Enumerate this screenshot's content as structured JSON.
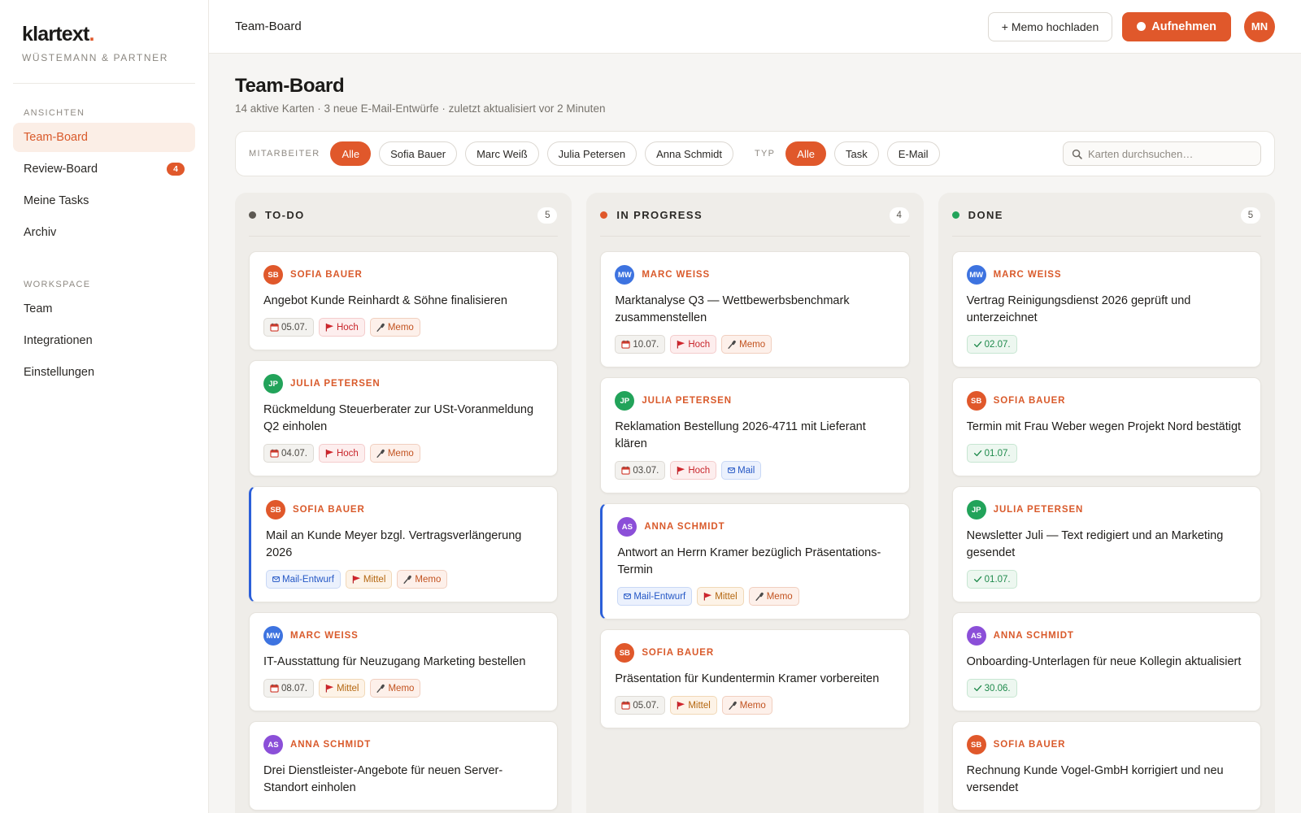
{
  "brand": {
    "name": "klartext",
    "dot": ".",
    "org": "WÜSTEMANN & PARTNER"
  },
  "sidebar": {
    "sections": [
      {
        "label": "ANSICHTEN",
        "items": [
          {
            "label": "Team-Board",
            "active": true
          },
          {
            "label": "Review-Board",
            "badge": "4"
          },
          {
            "label": "Meine Tasks"
          },
          {
            "label": "Archiv"
          }
        ]
      },
      {
        "label": "WORKSPACE",
        "items": [
          {
            "label": "Team"
          },
          {
            "label": "Integrationen"
          },
          {
            "label": "Einstellungen"
          }
        ]
      }
    ]
  },
  "topbar": {
    "title": "Team-Board",
    "upload_label": "+ Memo hochladen",
    "record_label": "Aufnehmen",
    "user_initials": "MN"
  },
  "page": {
    "title": "Team-Board",
    "subtitle": "14 aktive Karten · 3 neue E-Mail-Entwürfe · zuletzt aktualisiert vor 2 Minuten"
  },
  "filters": {
    "employee_label": "MITARBEITER",
    "employees": [
      "Alle",
      "Sofia Bauer",
      "Marc Weiß",
      "Julia Petersen",
      "Anna Schmidt"
    ],
    "employee_active": "Alle",
    "type_label": "TYP",
    "types": [
      "Alle",
      "Task",
      "E-Mail"
    ],
    "type_active": "Alle",
    "search_placeholder": "Karten durchsuchen…"
  },
  "colors": {
    "accent": "#e0582b",
    "sb": "#e0582b",
    "mw": "#3d73e0",
    "jp": "#22a35a",
    "as": "#8b4fd8"
  },
  "columns": [
    {
      "title": "TO-DO",
      "count": "5",
      "dot_color": "#5c5852",
      "cards": [
        {
          "initials": "SB",
          "avatar": "sb",
          "assignee": "SOFIA BAUER",
          "title": "Angebot Kunde Reinhardt & Söhne finalisieren",
          "tags": [
            {
              "type": "date",
              "label": "05.07."
            },
            {
              "type": "hoch",
              "label": "Hoch"
            },
            {
              "type": "memo",
              "label": "Memo"
            }
          ]
        },
        {
          "initials": "JP",
          "avatar": "jp",
          "assignee": "JULIA PETERSEN",
          "title": "Rückmeldung Steuerberater zur USt-Voranmeldung Q2 einholen",
          "tags": [
            {
              "type": "date",
              "label": "04.07."
            },
            {
              "type": "hoch",
              "label": "Hoch"
            },
            {
              "type": "memo",
              "label": "Memo"
            }
          ]
        },
        {
          "initials": "SB",
          "avatar": "sb",
          "assignee": "SOFIA BAUER",
          "title": "Mail an Kunde Meyer bzgl. Vertragsverlängerung 2026",
          "flagged": true,
          "tags": [
            {
              "type": "mail",
              "label": "Mail-Entwurf"
            },
            {
              "type": "mittel",
              "label": "Mittel"
            },
            {
              "type": "memo",
              "label": "Memo"
            }
          ]
        },
        {
          "initials": "MW",
          "avatar": "mw",
          "assignee": "MARC WEISS",
          "title": "IT-Ausstattung für Neuzugang Marketing bestellen",
          "tags": [
            {
              "type": "date",
              "label": "08.07."
            },
            {
              "type": "mittel",
              "label": "Mittel"
            },
            {
              "type": "memo",
              "label": "Memo"
            }
          ]
        },
        {
          "initials": "AS",
          "avatar": "as",
          "assignee": "ANNA SCHMIDT",
          "title": "Drei Dienstleister-Angebote für neuen Server-Standort einholen",
          "tags": []
        }
      ]
    },
    {
      "title": "IN PROGRESS",
      "count": "4",
      "dot_color": "#e0582b",
      "cards": [
        {
          "initials": "MW",
          "avatar": "mw",
          "assignee": "MARC WEISS",
          "title": "Marktanalyse Q3 — Wettbewerbsbenchmark zusammenstellen",
          "tags": [
            {
              "type": "date",
              "label": "10.07."
            },
            {
              "type": "hoch",
              "label": "Hoch"
            },
            {
              "type": "memo",
              "label": "Memo"
            }
          ]
        },
        {
          "initials": "JP",
          "avatar": "jp",
          "assignee": "JULIA PETERSEN",
          "title": "Reklamation Bestellung 2026-4711 mit Lieferant klären",
          "tags": [
            {
              "type": "date",
              "label": "03.07."
            },
            {
              "type": "hoch",
              "label": "Hoch"
            },
            {
              "type": "mail",
              "label": "Mail"
            }
          ]
        },
        {
          "initials": "AS",
          "avatar": "as",
          "assignee": "ANNA SCHMIDT",
          "title": "Antwort an Herrn Kramer bezüglich Präsentations-Termin",
          "flagged": true,
          "tags": [
            {
              "type": "mail",
              "label": "Mail-Entwurf"
            },
            {
              "type": "mittel",
              "label": "Mittel"
            },
            {
              "type": "memo",
              "label": "Memo"
            }
          ]
        },
        {
          "initials": "SB",
          "avatar": "sb",
          "assignee": "SOFIA BAUER",
          "title": "Präsentation für Kundentermin Kramer vorbereiten",
          "tags": [
            {
              "type": "date",
              "label": "05.07."
            },
            {
              "type": "mittel",
              "label": "Mittel"
            },
            {
              "type": "memo",
              "label": "Memo"
            }
          ]
        }
      ]
    },
    {
      "title": "DONE",
      "count": "5",
      "dot_color": "#22a35a",
      "cards": [
        {
          "initials": "MW",
          "avatar": "mw",
          "assignee": "MARC WEISS",
          "title": "Vertrag Reinigungsdienst 2026 geprüft und unterzeichnet",
          "tags": [
            {
              "type": "done",
              "label": "02.07."
            }
          ]
        },
        {
          "initials": "SB",
          "avatar": "sb",
          "assignee": "SOFIA BAUER",
          "title": "Termin mit Frau Weber wegen Projekt Nord bestätigt",
          "tags": [
            {
              "type": "done",
              "label": "01.07."
            }
          ]
        },
        {
          "initials": "JP",
          "avatar": "jp",
          "assignee": "JULIA PETERSEN",
          "title": "Newsletter Juli — Text redigiert und an Marketing gesendet",
          "tags": [
            {
              "type": "done",
              "label": "01.07."
            }
          ]
        },
        {
          "initials": "AS",
          "avatar": "as",
          "assignee": "ANNA SCHMIDT",
          "title": "Onboarding-Unterlagen für neue Kollegin aktualisiert",
          "tags": [
            {
              "type": "done",
              "label": "30.06."
            }
          ]
        },
        {
          "initials": "SB",
          "avatar": "sb",
          "assignee": "SOFIA BAUER",
          "title": "Rechnung Kunde Vogel-GmbH korrigiert und neu versendet",
          "tags": []
        }
      ]
    }
  ]
}
